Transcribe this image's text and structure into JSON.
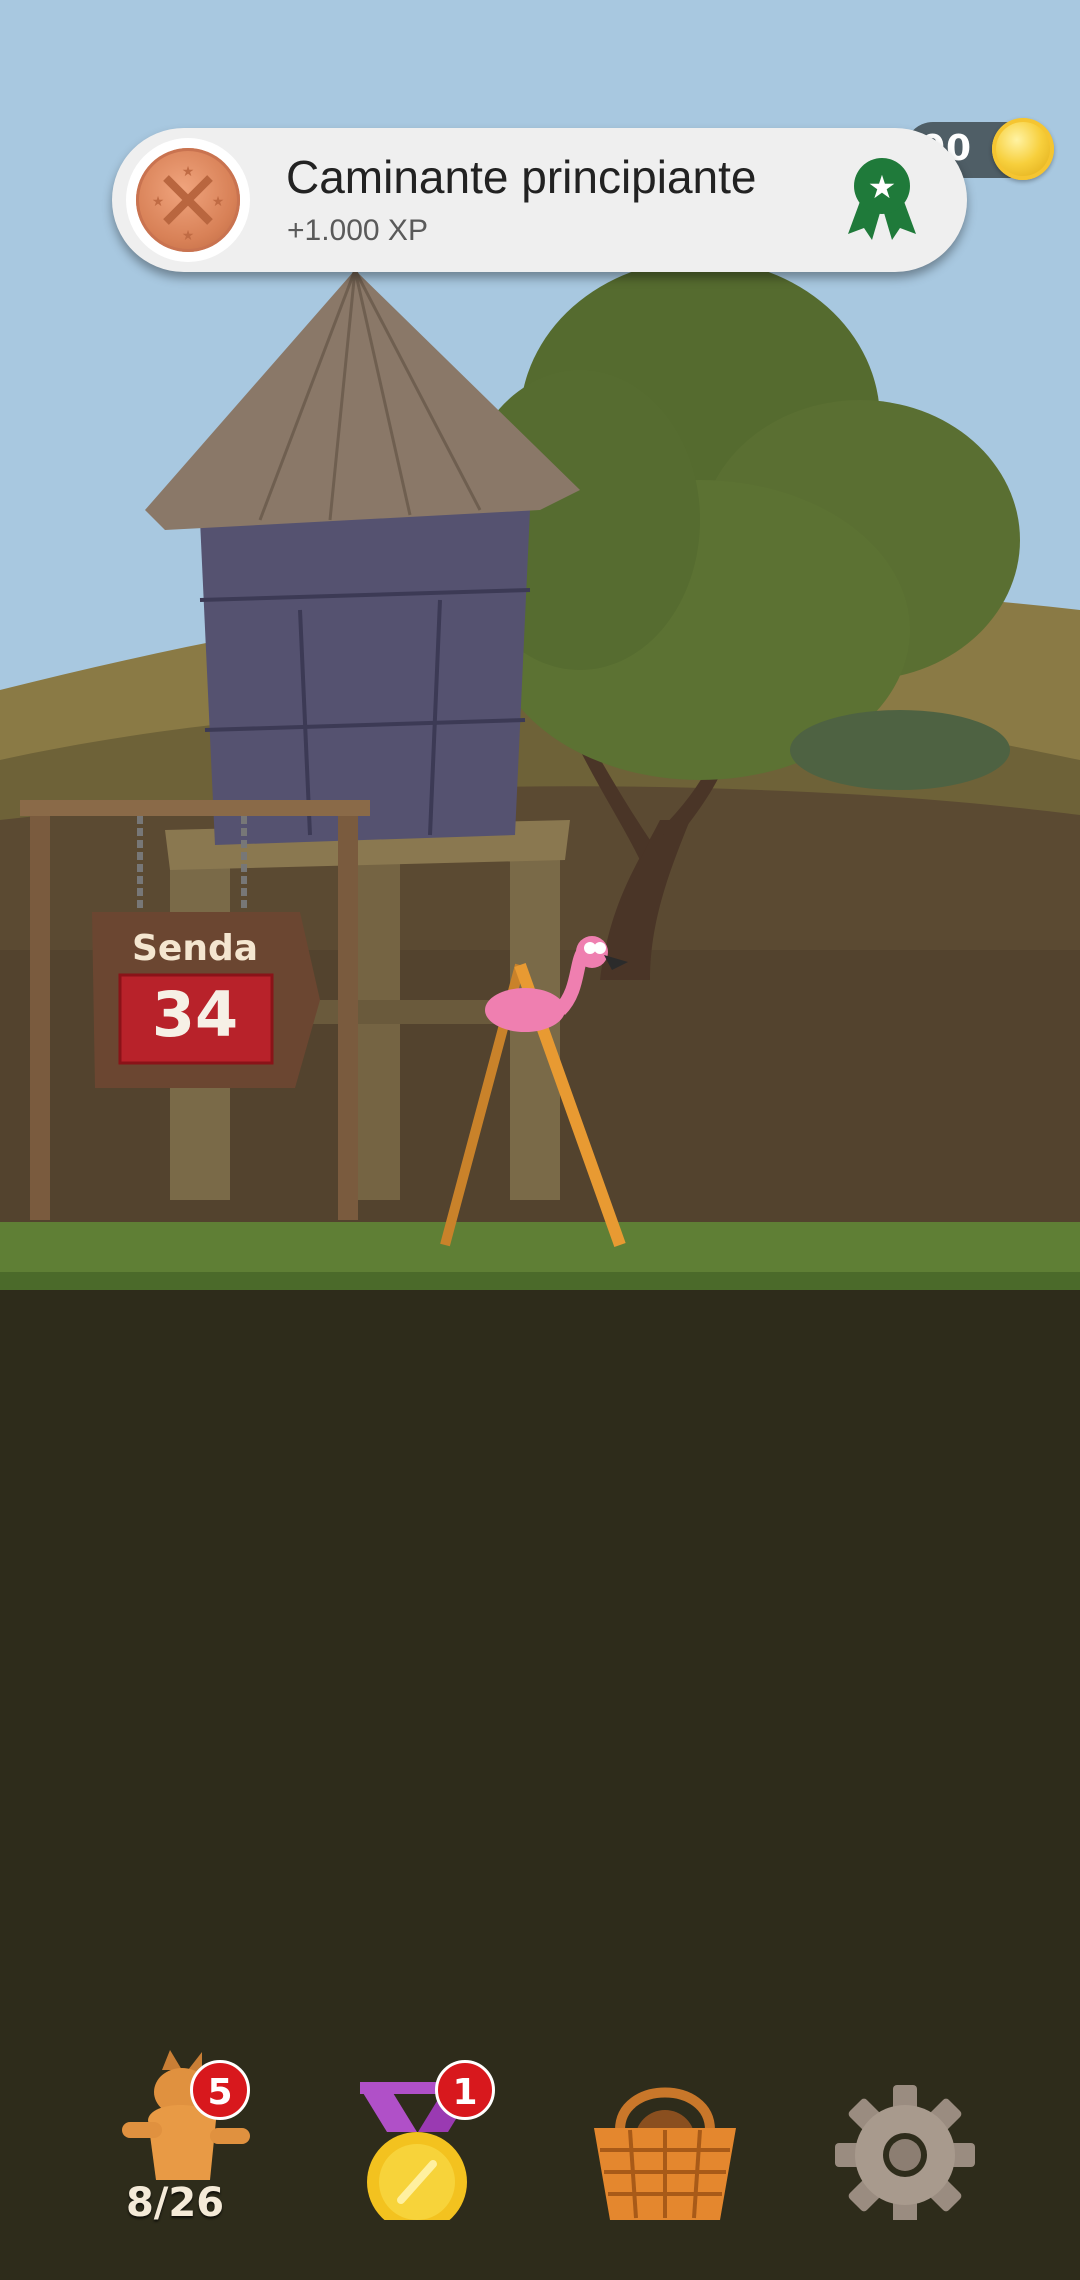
{
  "toast": {
    "title": "Caminante principiante",
    "subtitle": "+1.000 XP"
  },
  "coins": {
    "value": "00"
  },
  "sign": {
    "label": "Senda",
    "number": "34"
  },
  "nav": {
    "characters": {
      "badge": "5",
      "count": "8/26"
    },
    "achievements": {
      "badge": "1"
    },
    "shop": {},
    "settings": {}
  },
  "colors": {
    "sky": "#a8c8e0",
    "grass": "#5f7f35",
    "ground": "#2e2c1b",
    "badge": "#d8181d"
  }
}
